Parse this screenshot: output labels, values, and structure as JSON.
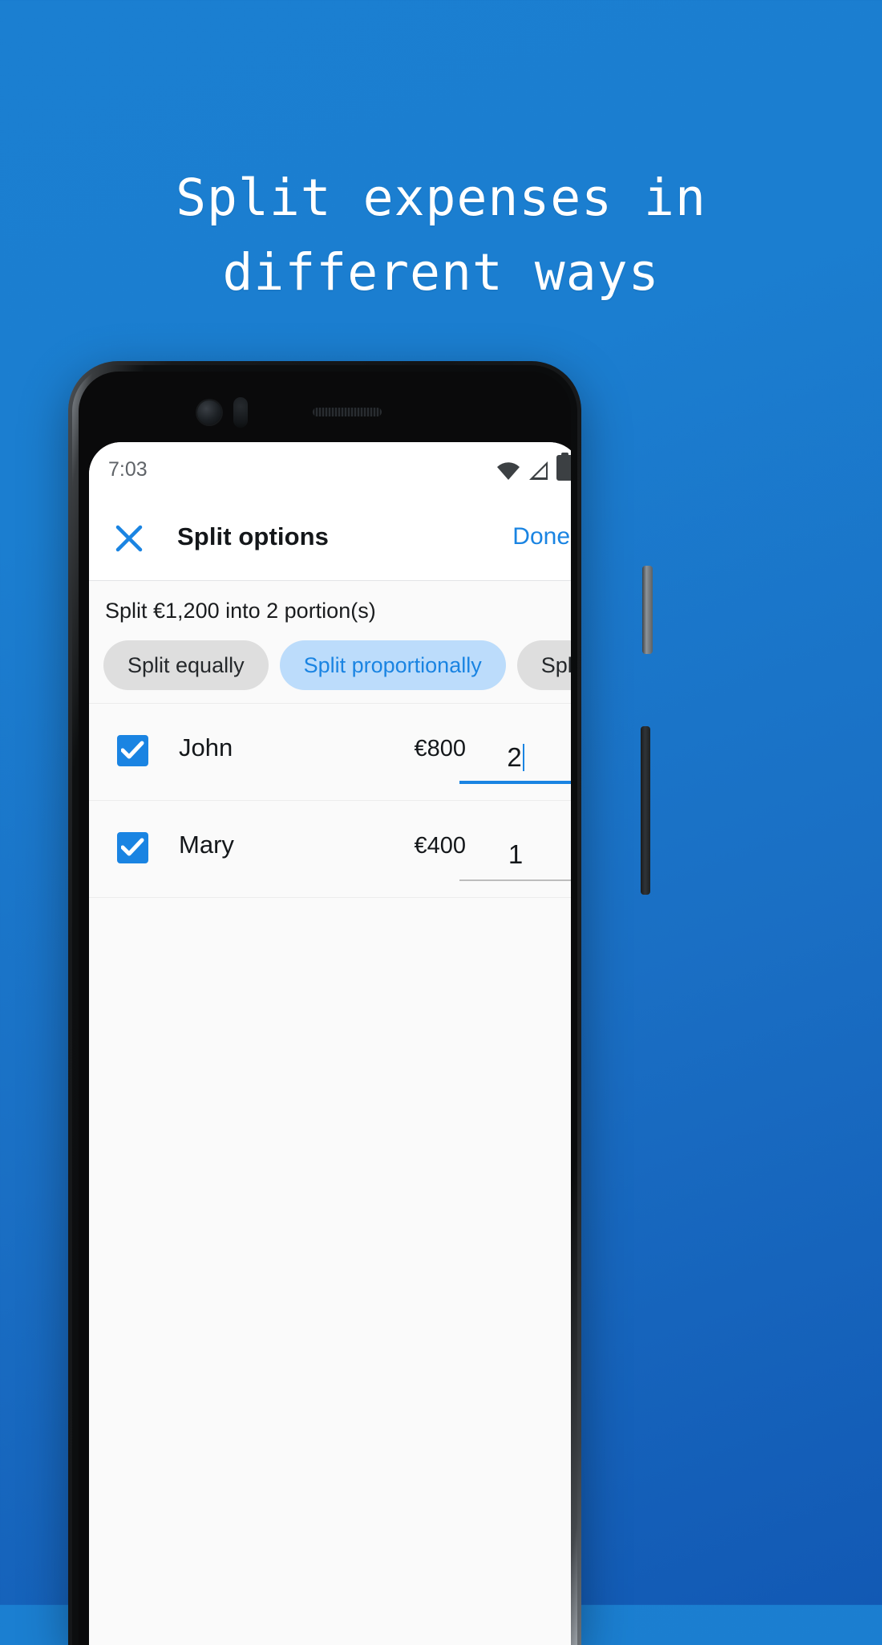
{
  "promo": {
    "headline_lines": [
      "Split expenses in",
      "different ways"
    ],
    "background_color": "#1b7fd1",
    "text_color": "#ffffff"
  },
  "phone": {
    "status_bar": {
      "time": "7:03",
      "icons": [
        "wifi-icon",
        "signal-icon",
        "battery-icon"
      ]
    },
    "app_bar": {
      "close_icon": "close-icon",
      "title": "Split options",
      "done_label": "Done",
      "accent_color": "#1a84e2"
    },
    "sheet": {
      "caption": "Split €1,200 into 2 portion(s)",
      "total_amount": "€1,200",
      "portions": "2",
      "chips": [
        {
          "label": "Split equally",
          "selected": false
        },
        {
          "label": "Split proportionally",
          "selected": true
        },
        {
          "label": "Split by amount",
          "selected": false
        }
      ],
      "rows": [
        {
          "name": "John",
          "amount": "€800",
          "portion": "2",
          "checked": true,
          "focused": true
        },
        {
          "name": "Mary",
          "amount": "€400",
          "portion": "1",
          "checked": true,
          "focused": false
        }
      ]
    }
  }
}
